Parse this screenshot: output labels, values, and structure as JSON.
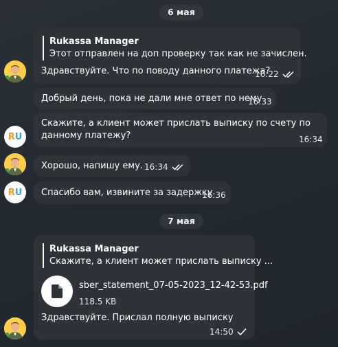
{
  "dates": [
    "6 мая",
    "7 мая"
  ],
  "messages": [
    {
      "reply_author": "Rukassa Manager",
      "reply_text": "Этот отправлен на доп проверку так как не зачислен.",
      "text": "Здравствуйте. Что по поводу данного платежа?",
      "time": "16:22"
    },
    {
      "text": "Добрый день, пока не дали мне ответ по нему",
      "time": "16:33"
    },
    {
      "text_line1": "Скажите, а клиент может прислать выписку по счету по",
      "text_line2": "данному платежу?",
      "time": "16:34"
    },
    {
      "text": "Хорошо, напишу ему.",
      "time": "16:34"
    },
    {
      "text": "Спасибо вам, извините за задержку",
      "time": "16:36"
    },
    {
      "reply_author": "Rukassa Manager",
      "reply_text": "Скажите, а клиент может прислать выписку ...",
      "file_name": "sber_statement_07-05-2023_12-42-53.pdf",
      "file_size": "118.5 KB",
      "text": "Здравствуйте. Прислал полную выписку",
      "time": "14:50"
    }
  ],
  "avatars": {
    "manager": "manager-avatar",
    "support": "RU"
  },
  "colors": {
    "bubble": "#2e3339",
    "background": "#262d33"
  }
}
